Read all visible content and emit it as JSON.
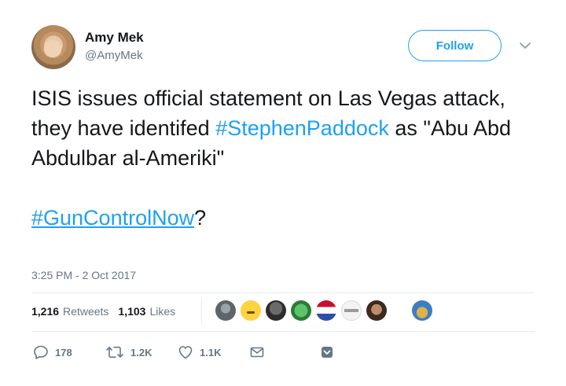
{
  "author": {
    "name": "Amy Mek",
    "handle": "@AmyMek"
  },
  "follow_button": {
    "label": "Follow"
  },
  "tweet": {
    "line_text_1": "ISIS issues official statement on Las Vegas attack, they have identifed",
    "hashtag_1": "#StephenPaddock",
    "line_text_2": " as \"Abu Abd  Abdulbar al-Ameriki\"",
    "hashtag_2": "#GunControlNow",
    "suffix_2": "?"
  },
  "timestamp": "3:25 PM - 2 Oct 2017",
  "stats": {
    "retweets_count": "1,216",
    "retweets_label": "Retweets",
    "likes_count": "1,103",
    "likes_label": "Likes"
  },
  "actions": {
    "reply_count": "178",
    "retweet_count": "1.2K",
    "like_count": "1.1K"
  },
  "colors": {
    "accent": "#1da1f2",
    "text": "#14171a",
    "muted": "#657786",
    "divider": "#e6ecf0"
  }
}
